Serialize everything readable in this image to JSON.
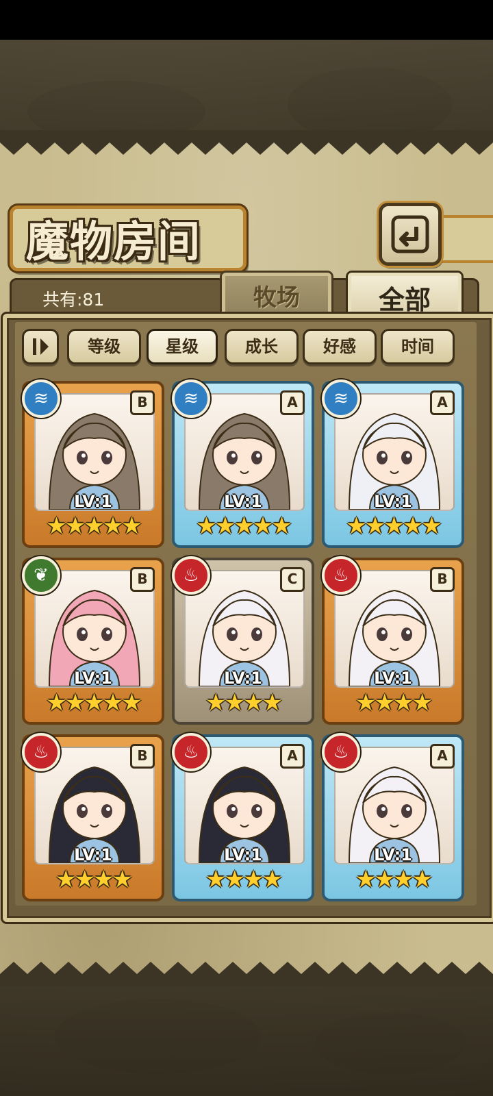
{
  "header": {
    "title": "魔物房间",
    "total_label": "共有:81"
  },
  "tabs": [
    {
      "label": "牧场",
      "selected": false
    },
    {
      "label": "全部",
      "selected": true
    }
  ],
  "sort_buttons": [
    {
      "label": "等级",
      "active": false
    },
    {
      "label": "星级",
      "active": true
    },
    {
      "label": "成长",
      "active": false
    },
    {
      "label": "好感",
      "active": false
    },
    {
      "label": "时间",
      "active": false
    }
  ],
  "monsters": [
    {
      "element": "water",
      "element_icon": "water-icon",
      "rank": "B",
      "level": "LV:1",
      "stars": 5,
      "hair": "#8a7a6a"
    },
    {
      "element": "water",
      "element_icon": "water-icon",
      "rank": "A",
      "level": "LV:1",
      "stars": 5,
      "hair": "#8a7a6a"
    },
    {
      "element": "water",
      "element_icon": "water-icon",
      "rank": "A",
      "level": "LV:1",
      "stars": 5,
      "hair": "#eef0f6"
    },
    {
      "element": "earth",
      "element_icon": "leaf-icon",
      "rank": "B",
      "level": "LV:1",
      "stars": 5,
      "hair": "#f2a7b7"
    },
    {
      "element": "fire",
      "element_icon": "flame-icon",
      "rank": "C",
      "level": "LV:1",
      "stars": 4,
      "hair": "#f4f1f6"
    },
    {
      "element": "fire",
      "element_icon": "flame-icon",
      "rank": "B",
      "level": "LV:1",
      "stars": 4,
      "hair": "#f4f1f6"
    },
    {
      "element": "fire",
      "element_icon": "flame-icon",
      "rank": "B",
      "level": "LV:1",
      "stars": 4,
      "hair": "#2a2a36"
    },
    {
      "element": "fire",
      "element_icon": "flame-icon",
      "rank": "A",
      "level": "LV:1",
      "stars": 4,
      "hair": "#2a2a36"
    },
    {
      "element": "fire",
      "element_icon": "flame-icon",
      "rank": "A",
      "level": "LV:1",
      "stars": 4,
      "hair": "#f4f1f6"
    }
  ]
}
